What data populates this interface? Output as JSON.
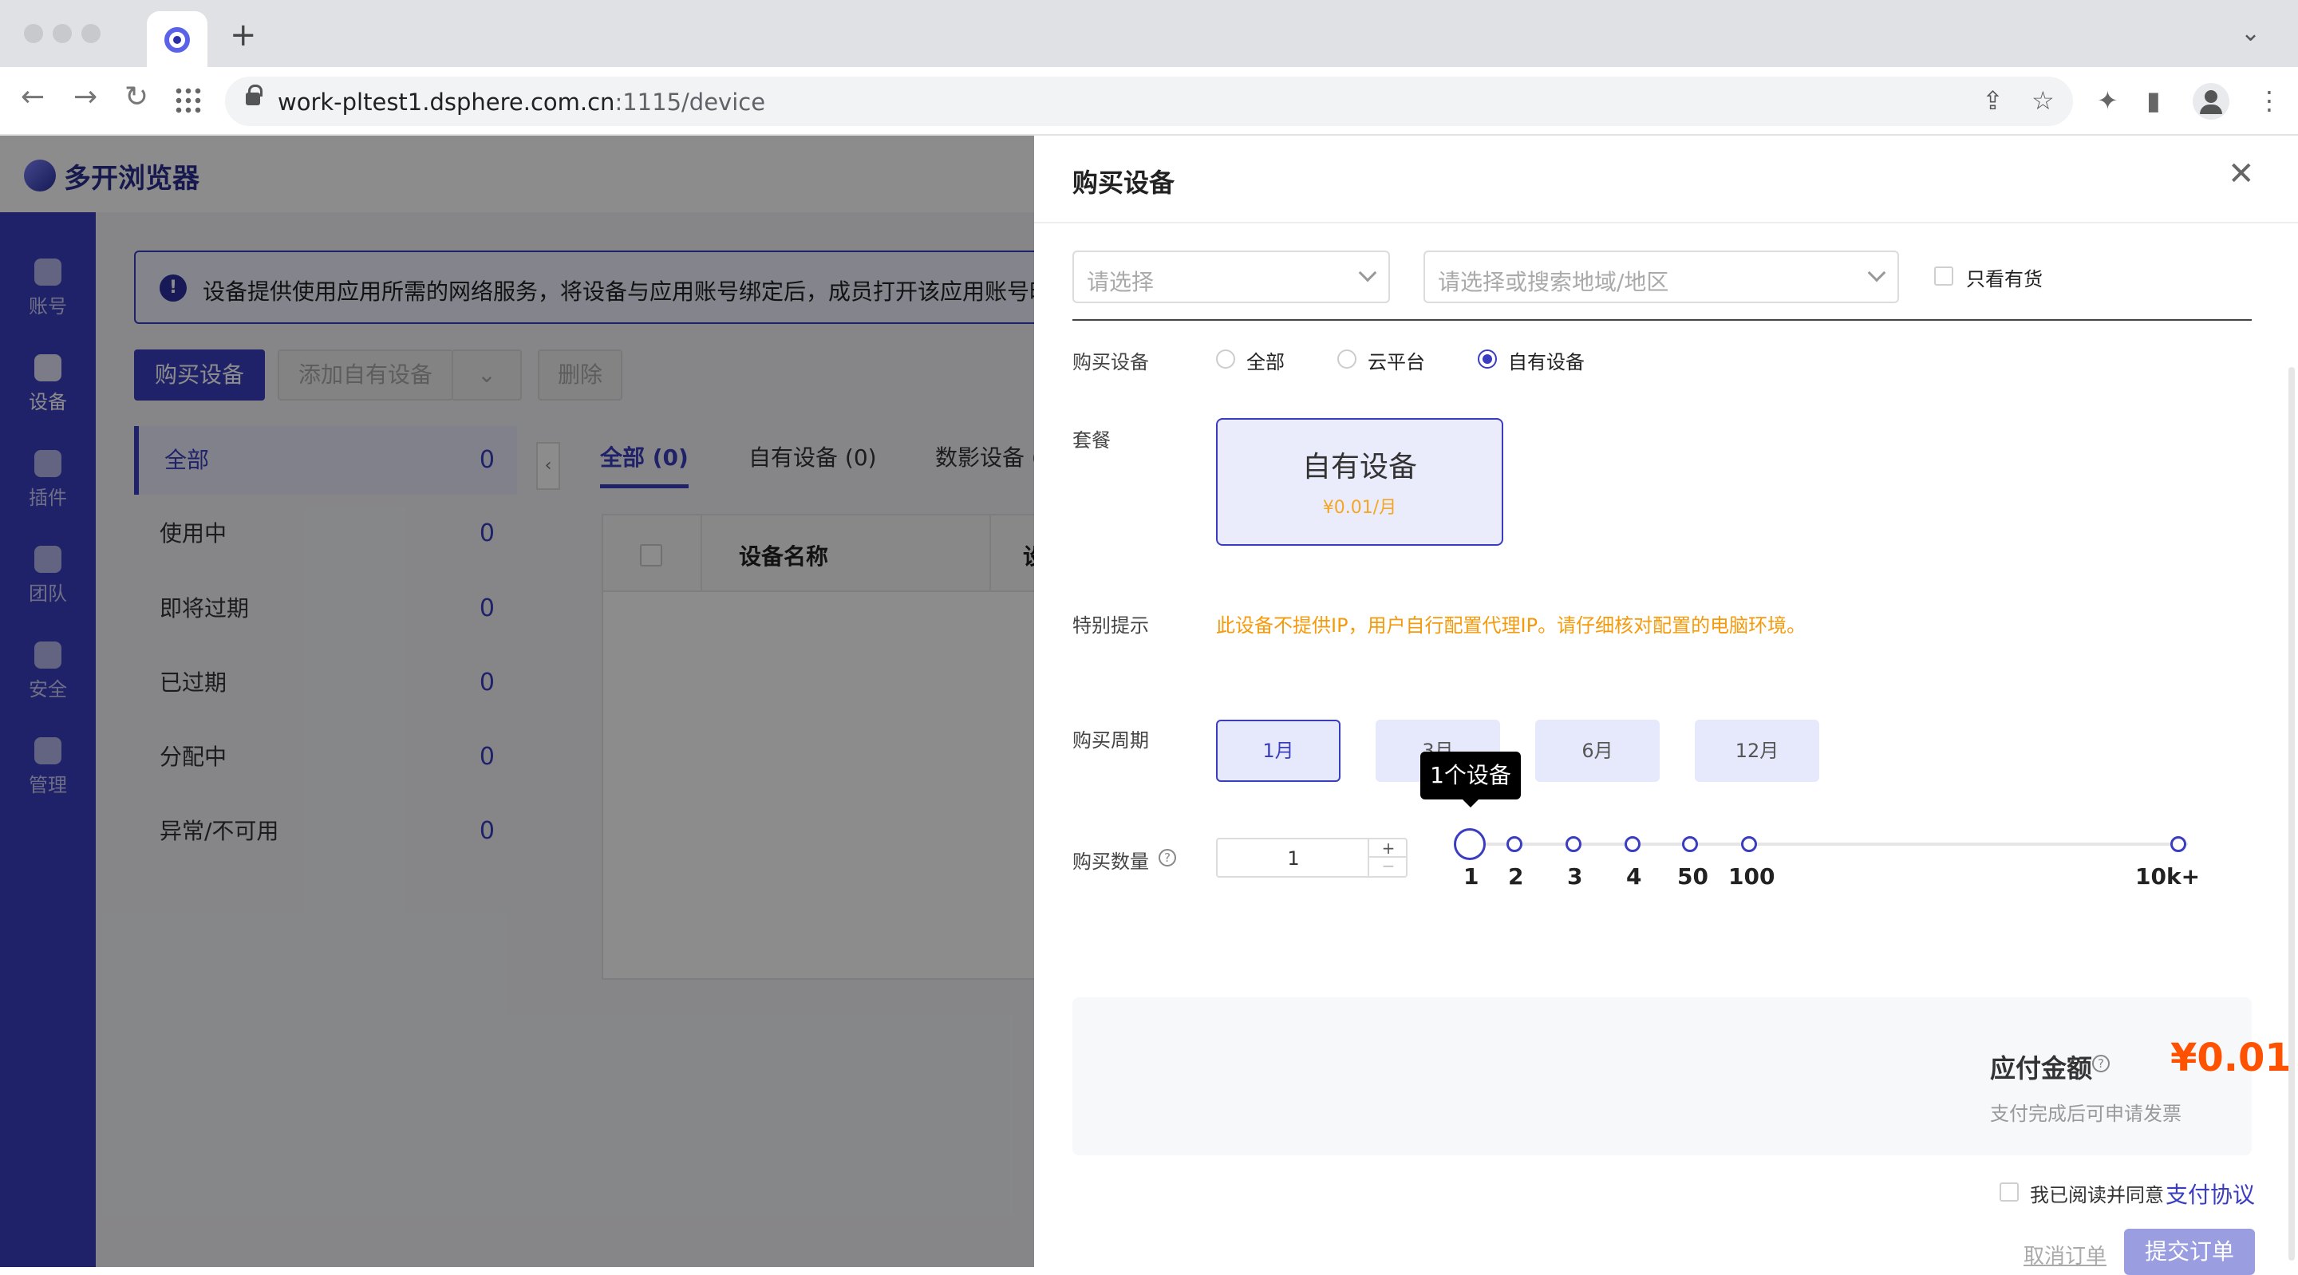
{
  "browser": {
    "url_host": "work-pltest1.dsphere.com.cn",
    "url_path": ":1115/device",
    "new_tab": "+"
  },
  "app": {
    "name": "多开浏览器",
    "nav": [
      {
        "label": "账号",
        "icon": "user-icon"
      },
      {
        "label": "设备",
        "icon": "wifi-icon"
      },
      {
        "label": "插件",
        "icon": "puzzle-icon"
      },
      {
        "label": "团队",
        "icon": "building-icon"
      },
      {
        "label": "安全",
        "icon": "shield-icon"
      },
      {
        "label": "管理",
        "icon": "gear-icon"
      }
    ],
    "notice": "设备提供使用应用所需的网络服务，将设备与应用账号绑定后，成员打开该应用账号时",
    "buttons": {
      "buy": "购买设备",
      "add_own": "添加自有设备",
      "delete": "删除"
    },
    "status": [
      {
        "label": "全部",
        "count": "0"
      },
      {
        "label": "使用中",
        "count": "0"
      },
      {
        "label": "即将过期",
        "count": "0"
      },
      {
        "label": "已过期",
        "count": "0"
      },
      {
        "label": "分配中",
        "count": "0"
      },
      {
        "label": "异常/不可用",
        "count": "0"
      }
    ],
    "tabs": [
      "全部 (0)",
      "自有设备 (0)",
      "数影设备 ("
    ],
    "table": {
      "col_name": "设备名称",
      "col_next": "设"
    }
  },
  "drawer": {
    "title": "购买设备",
    "filter": {
      "select_placeholder": "请选择",
      "region_placeholder": "请选择或搜索地域/地区",
      "in_stock_label": "只看有货"
    },
    "purchase_type": {
      "label": "购买设备",
      "options": [
        "全部",
        "云平台",
        "自有设备"
      ],
      "selected": "自有设备"
    },
    "plan": {
      "label": "套餐",
      "name": "自有设备",
      "price": "¥0.01/月"
    },
    "tip": {
      "label": "特别提示",
      "text": "此设备不提供IP，用户自行配置代理IP。请仔细核对配置的电脑环境。"
    },
    "period": {
      "label": "购买周期",
      "options": [
        "1月",
        "3月",
        "6月",
        "12月"
      ],
      "selected": "1月"
    },
    "quantity": {
      "label": "购买数量",
      "value": "1",
      "plus": "+",
      "minus": "−",
      "tooltip": "1个设备",
      "marks": [
        "1",
        "2",
        "3",
        "4",
        "50",
        "100",
        "10k+"
      ]
    },
    "total": {
      "label": "应付金额",
      "amount": "¥0.01",
      "sub": "支付完成后可申请发票"
    },
    "agreement": {
      "text": "我已阅读并同意",
      "link": "支付协议"
    },
    "footer": {
      "cancel": "取消订单",
      "submit": "提交订单"
    }
  }
}
